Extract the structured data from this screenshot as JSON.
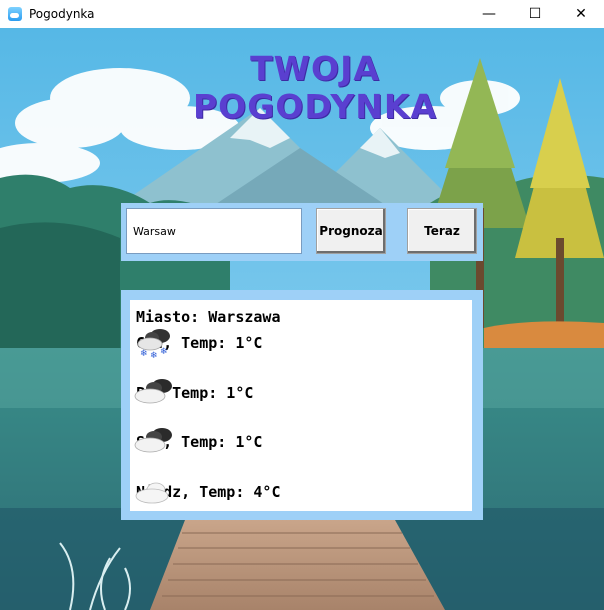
{
  "window": {
    "title": "Pogodynka",
    "minimize_glyph": "—",
    "maximize_glyph": "☐",
    "close_glyph": "✕"
  },
  "header": {
    "line1": "TWOJA",
    "line2": "POGODYNKA"
  },
  "search": {
    "city_value": "Warsaw",
    "forecast_label": "Prognoza",
    "now_label": "Teraz"
  },
  "forecast": {
    "city_line": "Miasto: Warszawa",
    "days": [
      {
        "text": "Czw, Temp: 1°C",
        "icon": "cloud-snow-icon"
      },
      {
        "text": "Pt, Temp: 1°C",
        "icon": "dark-clouds-icon"
      },
      {
        "text": "Sob, Temp: 1°C",
        "icon": "dark-clouds-icon"
      },
      {
        "text": "Niedz, Temp: 4°C",
        "icon": "cloud-icon"
      }
    ]
  },
  "colors": {
    "headline": "#5a3fd0",
    "panel": "#9ed0f7"
  }
}
